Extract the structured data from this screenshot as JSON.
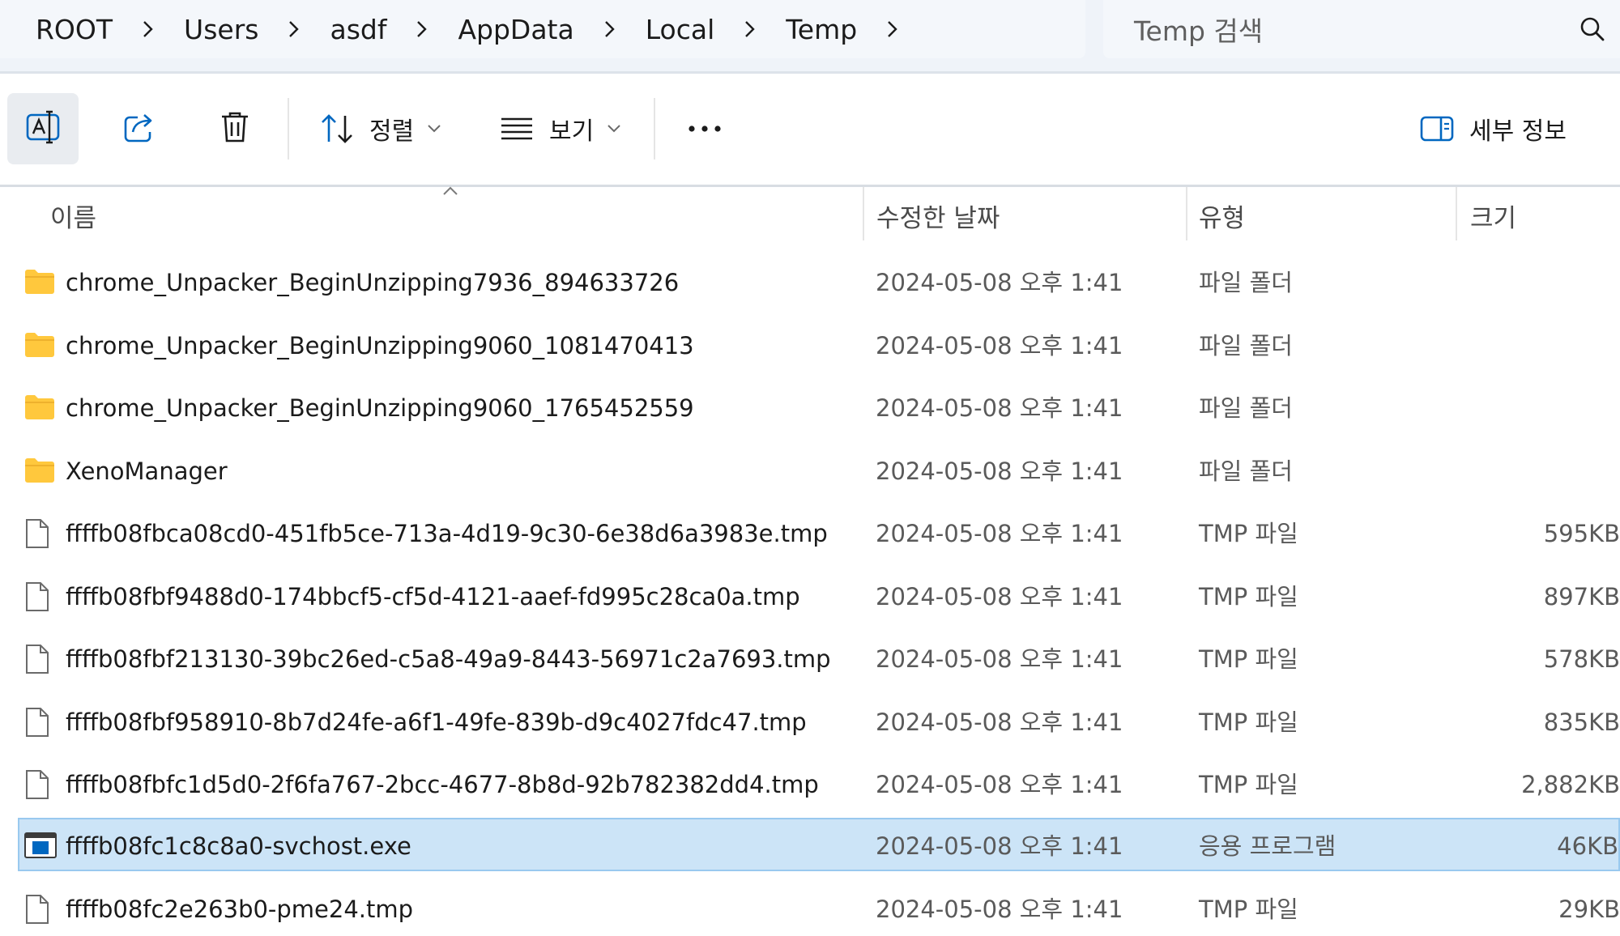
{
  "breadcrumb": {
    "items": [
      {
        "label": "ROOT"
      },
      {
        "label": "Users"
      },
      {
        "label": "asdf"
      },
      {
        "label": "AppData"
      },
      {
        "label": "Local"
      },
      {
        "label": "Temp"
      }
    ]
  },
  "search": {
    "placeholder": "Temp 검색"
  },
  "toolbar": {
    "sort_label": "정렬",
    "view_label": "보기",
    "details_label": "세부 정보"
  },
  "columns": {
    "name": "이름",
    "date": "수정한 날짜",
    "type": "유형",
    "size": "크기"
  },
  "files": [
    {
      "name": "chrome_Unpacker_BeginUnzipping7936_894633726",
      "date": "2024-05-08 오후 1:41",
      "type": "파일 폴더",
      "size": "",
      "icon": "folder-icon",
      "selected": false
    },
    {
      "name": "chrome_Unpacker_BeginUnzipping9060_1081470413",
      "date": "2024-05-08 오후 1:41",
      "type": "파일 폴더",
      "size": "",
      "icon": "folder-icon",
      "selected": false
    },
    {
      "name": "chrome_Unpacker_BeginUnzipping9060_1765452559",
      "date": "2024-05-08 오후 1:41",
      "type": "파일 폴더",
      "size": "",
      "icon": "folder-icon",
      "selected": false
    },
    {
      "name": "XenoManager",
      "date": "2024-05-08 오후 1:41",
      "type": "파일 폴더",
      "size": "",
      "icon": "folder-icon",
      "selected": false
    },
    {
      "name": "ffffb08fbca08cd0-451fb5ce-713a-4d19-9c30-6e38d6a3983e.tmp",
      "date": "2024-05-08 오후 1:41",
      "type": "TMP 파일",
      "size": "595KB",
      "icon": "file-icon",
      "selected": false
    },
    {
      "name": "ffffb08fbf9488d0-174bbcf5-cf5d-4121-aaef-fd995c28ca0a.tmp",
      "date": "2024-05-08 오후 1:41",
      "type": "TMP 파일",
      "size": "897KB",
      "icon": "file-icon",
      "selected": false
    },
    {
      "name": "ffffb08fbf213130-39bc26ed-c5a8-49a9-8443-56971c2a7693.tmp",
      "date": "2024-05-08 오후 1:41",
      "type": "TMP 파일",
      "size": "578KB",
      "icon": "file-icon",
      "selected": false
    },
    {
      "name": "ffffb08fbf958910-8b7d24fe-a6f1-49fe-839b-d9c4027fdc47.tmp",
      "date": "2024-05-08 오후 1:41",
      "type": "TMP 파일",
      "size": "835KB",
      "icon": "file-icon",
      "selected": false
    },
    {
      "name": "ffffb08fbfc1d5d0-2f6fa767-2bcc-4677-8b8d-92b782382dd4.tmp",
      "date": "2024-05-08 오후 1:41",
      "type": "TMP 파일",
      "size": "2,882KB",
      "icon": "file-icon",
      "selected": false
    },
    {
      "name": "ffffb08fc1c8c8a0-svchost.exe",
      "date": "2024-05-08 오후 1:41",
      "type": "응용 프로그램",
      "size": "46KB",
      "icon": "application-icon",
      "selected": true
    },
    {
      "name": "ffffb08fc2e263b0-pme24.tmp",
      "date": "2024-05-08 오후 1:41",
      "type": "TMP 파일",
      "size": "29KB",
      "icon": "file-icon",
      "selected": false
    }
  ],
  "colors": {
    "selection_bg": "#cce4f7",
    "selection_border": "#99c9ef",
    "folder_yellow": "#ffc83d",
    "accent_blue": "#0067c0"
  }
}
